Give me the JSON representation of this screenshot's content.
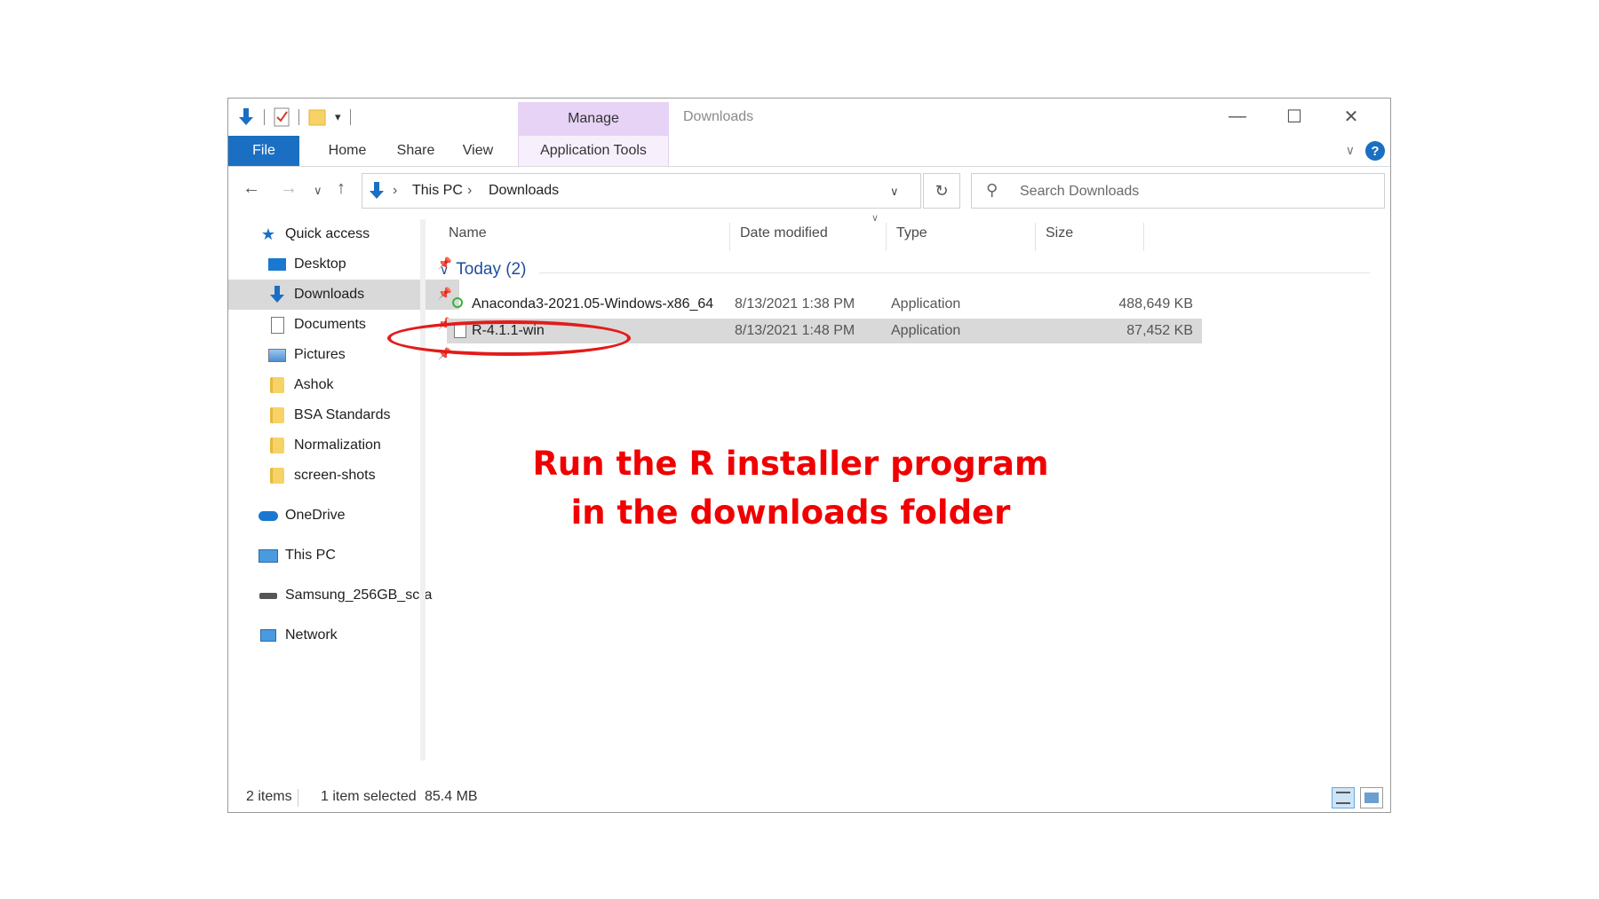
{
  "window": {
    "title": "Downloads",
    "manage_tab": "Manage",
    "controls": {
      "minimize": "—",
      "maximize": "☐",
      "close": "✕"
    }
  },
  "ribbon": {
    "tabs": [
      "File",
      "Home",
      "Share",
      "View",
      "Application Tools"
    ],
    "help": "?"
  },
  "address": {
    "crumbs": [
      "This PC",
      "Downloads"
    ],
    "search_placeholder": "Search Downloads"
  },
  "sidebar": {
    "quick_access": "Quick access",
    "pinned": [
      "Desktop",
      "Downloads",
      "Documents",
      "Pictures"
    ],
    "folders": [
      "Ashok",
      "BSA Standards",
      "Normalization",
      "screen-shots"
    ],
    "onedrive": "OneDrive",
    "this_pc": "This PC",
    "drive": "Samsung_256GB_scra",
    "network": "Network",
    "selected": "Downloads"
  },
  "columns": [
    "Name",
    "Date modified",
    "Type",
    "Size"
  ],
  "group": "Today (2)",
  "files": [
    {
      "name": "Anaconda3-2021.05-Windows-x86_64",
      "date": "8/13/2021 1:38 PM",
      "type": "Application",
      "size": "488,649 KB",
      "icon": "anaconda-icon",
      "selected": false
    },
    {
      "name": "R-4.1.1-win",
      "date": "8/13/2021 1:48 PM",
      "type": "Application",
      "size": "87,452 KB",
      "icon": "file-icon",
      "selected": true
    }
  ],
  "status": {
    "items": "2 items",
    "selected": "1 item selected",
    "size": "85.4 MB"
  },
  "annotation": {
    "line1": "Run the R installer program",
    "line2": "in the downloads folder",
    "color": "#f00000"
  }
}
